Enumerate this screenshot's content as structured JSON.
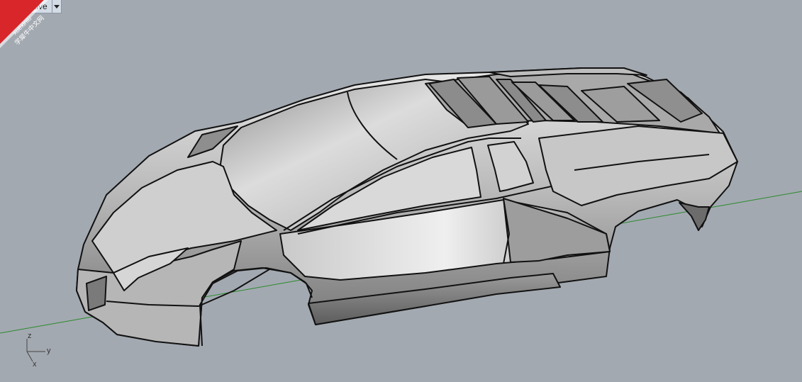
{
  "viewport": {
    "title": "Perspective",
    "background_color": "#a3a9b1",
    "grid_axis_color": "#2a8a2a"
  },
  "watermark": {
    "line1": "xuexiniu",
    "line2": "学犀牛中文网",
    "color": "#d9262a"
  },
  "axes": {
    "z": "z",
    "y": "y",
    "x": "x"
  }
}
